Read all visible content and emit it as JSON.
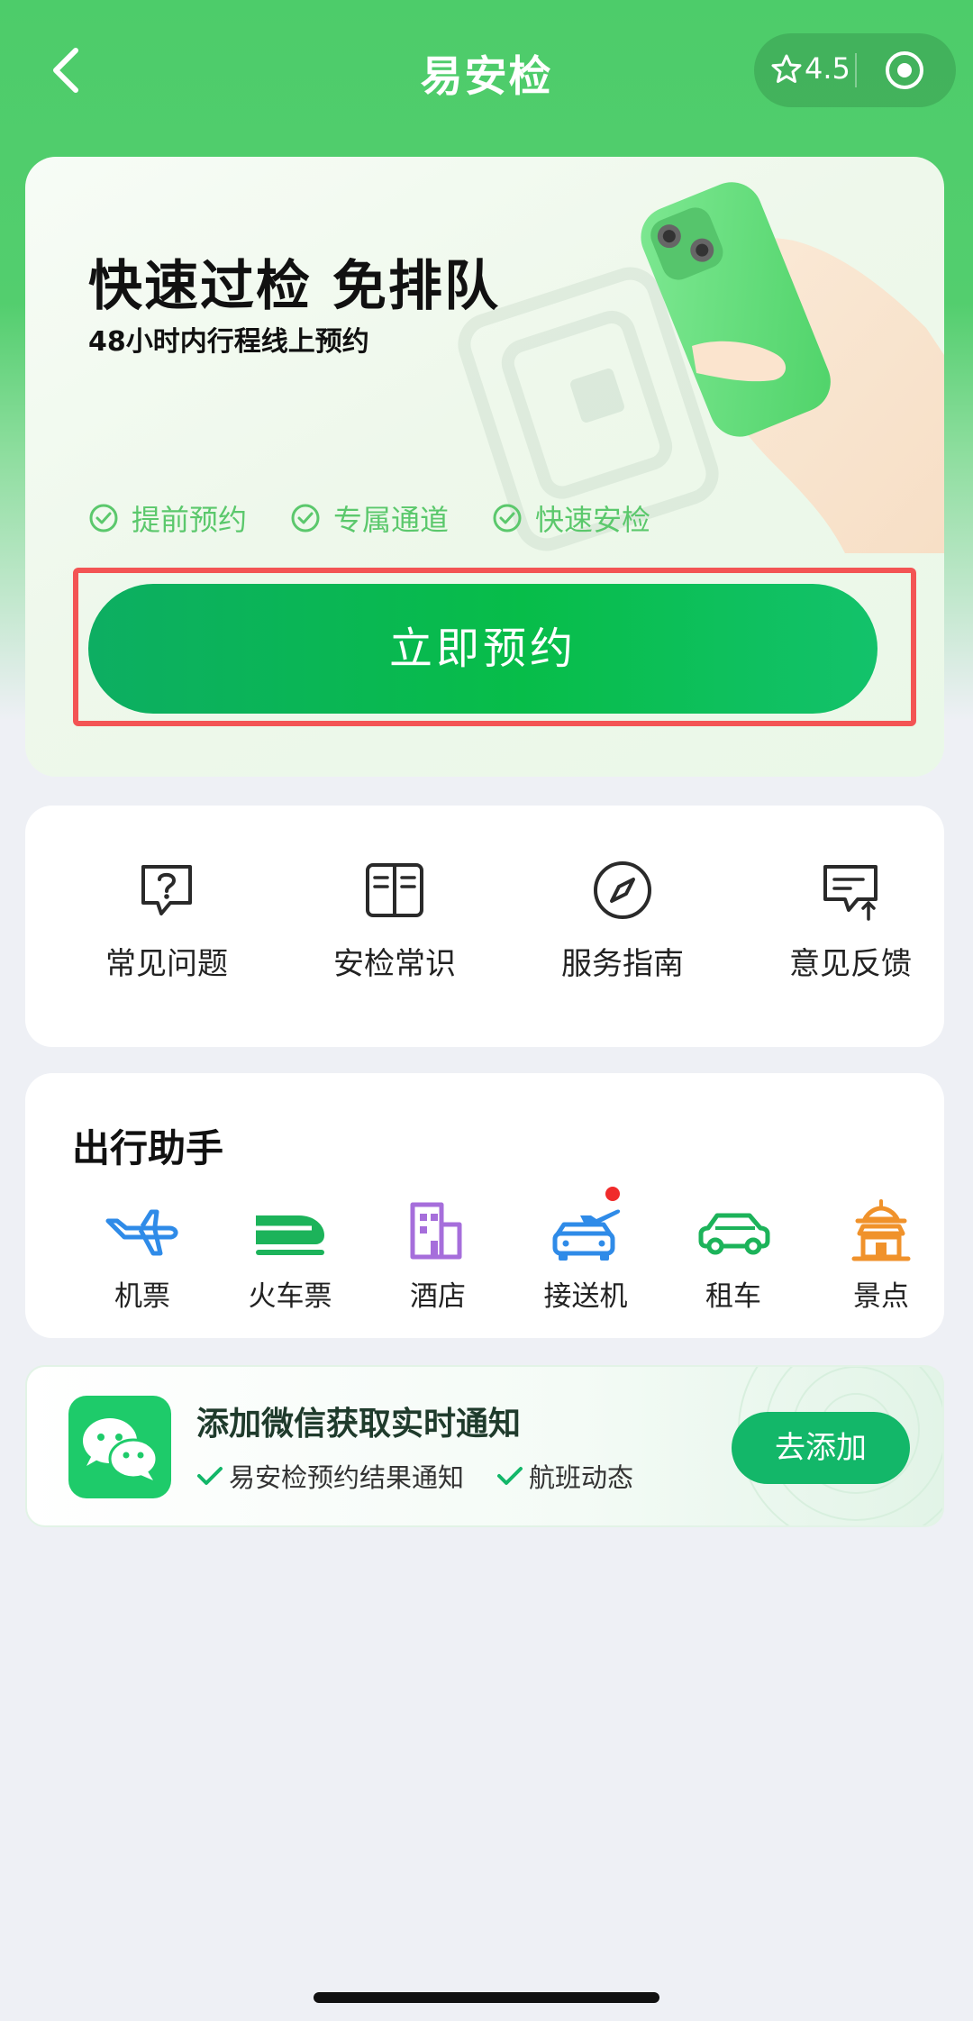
{
  "nav": {
    "title": "易安检",
    "rating": "4.5"
  },
  "hero": {
    "title": "快速过检 免排队",
    "subtitle": "48小时内行程线上预约",
    "features": [
      "提前预约",
      "专属通道",
      "快速安检"
    ],
    "book_label": "立即预约"
  },
  "quick_links": [
    {
      "label": "常见问题",
      "icon": "question-bubble-icon"
    },
    {
      "label": "安检常识",
      "icon": "book-icon"
    },
    {
      "label": "服务指南",
      "icon": "compass-icon"
    },
    {
      "label": "意见反馈",
      "icon": "feedback-icon"
    }
  ],
  "assistant": {
    "title": "出行助手",
    "items": [
      {
        "label": "机票",
        "icon": "airplane-icon"
      },
      {
        "label": "火车票",
        "icon": "train-icon"
      },
      {
        "label": "酒店",
        "icon": "hotel-icon"
      },
      {
        "label": "接送机",
        "icon": "airport-transfer-icon"
      },
      {
        "label": "租车",
        "icon": "car-rental-icon"
      },
      {
        "label": "景点",
        "icon": "attraction-icon"
      }
    ]
  },
  "wechat": {
    "title": "添加微信获取实时通知",
    "bullets": [
      "易安检预约结果通知",
      "航班动态"
    ],
    "add_label": "去添加"
  },
  "colors": {
    "brand_green": "#07BD49",
    "accent_green": "#5BC86C",
    "highlight_red": "#F35454",
    "dot_red": "#F02B2B"
  }
}
